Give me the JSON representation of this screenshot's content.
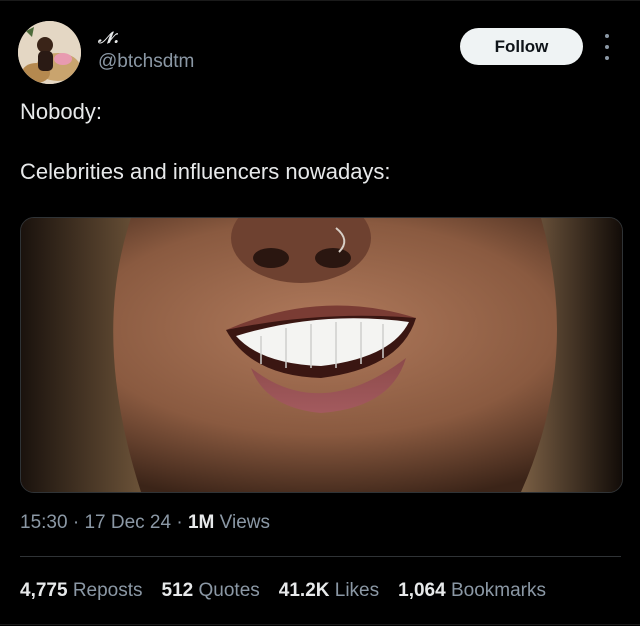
{
  "author": {
    "display_name": "𝒩.",
    "handle": "@btchsdtm"
  },
  "follow_label": "Follow",
  "tweet": {
    "line1": "Nobody:",
    "line2": "Celebrities and influencers nowadays:"
  },
  "meta": {
    "time": "15:30",
    "date": "17 Dec 24",
    "views_count": "1M",
    "views_label": "Views"
  },
  "stats": [
    {
      "count": "4,775",
      "label": "Reposts"
    },
    {
      "count": "512",
      "label": "Quotes"
    },
    {
      "count": "41.2K",
      "label": "Likes"
    },
    {
      "count": "1,064",
      "label": "Bookmarks"
    }
  ],
  "colors": {
    "background": "#000000",
    "text_primary": "#e7e9ea",
    "text_secondary": "#8b98a5",
    "follow_button_bg": "#eff3f4"
  },
  "icons": [
    "more-options-icon"
  ]
}
